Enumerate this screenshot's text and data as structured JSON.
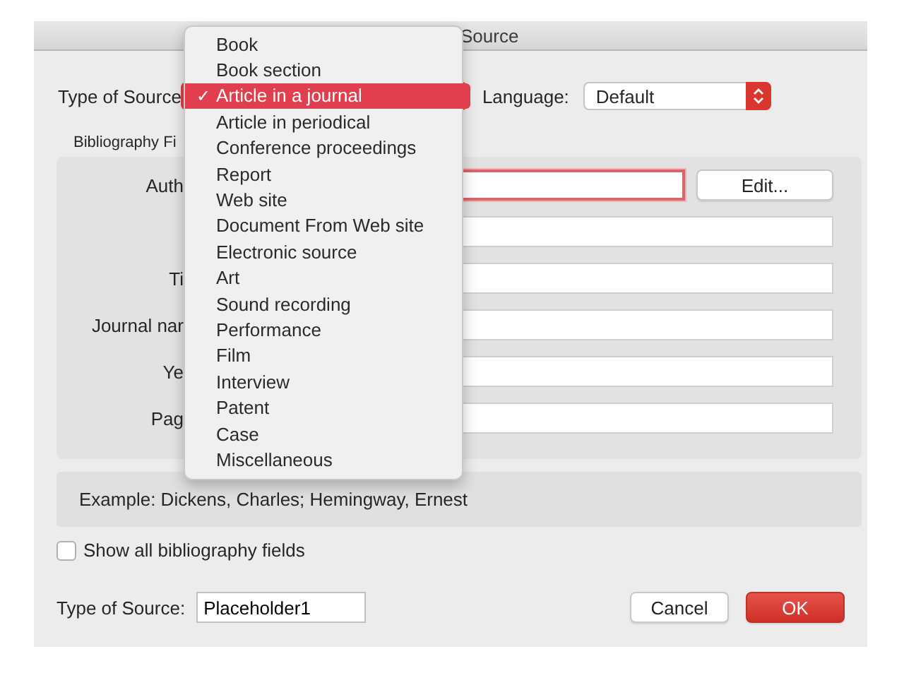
{
  "window": {
    "title": "Source"
  },
  "type_of_source": {
    "label": "Type of Source",
    "value_selected": true
  },
  "language": {
    "label": "Language:",
    "value": "Default"
  },
  "bibliography_group": {
    "label": "Bibliography Fi",
    "fields": [
      {
        "label": "Auth",
        "focused": true,
        "button": "Edit..."
      },
      {
        "focused": false
      },
      {
        "label": "Ti",
        "focused": false
      },
      {
        "label": "Journal nar",
        "focused": false
      },
      {
        "label": "Ye",
        "focused": false
      },
      {
        "label": "Pag",
        "focused": false
      }
    ]
  },
  "example": "Example: Dickens, Charles; Hemingway, Ernest",
  "show_all": {
    "label": "Show all bibliography fields",
    "checked": false
  },
  "tag": {
    "label": "Type of Source:",
    "value": "Placeholder1"
  },
  "buttons": [
    {
      "label": "Cancel",
      "kind": "secondary"
    },
    {
      "label": "OK",
      "kind": "primary"
    }
  ],
  "menu_check": "✓",
  "source_menu": [
    {
      "label": "Book",
      "selected": false
    },
    {
      "label": "Book section",
      "selected": false
    },
    {
      "label": "Article in a journal",
      "selected": true
    },
    {
      "label": "Article in periodical",
      "selected": false
    },
    {
      "label": "Conference proceedings",
      "selected": false
    },
    {
      "label": "Report",
      "selected": false
    },
    {
      "label": "Web site",
      "selected": false
    },
    {
      "label": "Document From Web site",
      "selected": false
    },
    {
      "label": "Electronic source",
      "selected": false
    },
    {
      "label": "Art",
      "selected": false
    },
    {
      "label": "Sound recording",
      "selected": false
    },
    {
      "label": "Performance",
      "selected": false
    },
    {
      "label": "Film",
      "selected": false
    },
    {
      "label": "Interview",
      "selected": false
    },
    {
      "label": "Patent",
      "selected": false
    },
    {
      "label": "Case",
      "selected": false
    },
    {
      "label": "Miscellaneous",
      "selected": false
    }
  ]
}
